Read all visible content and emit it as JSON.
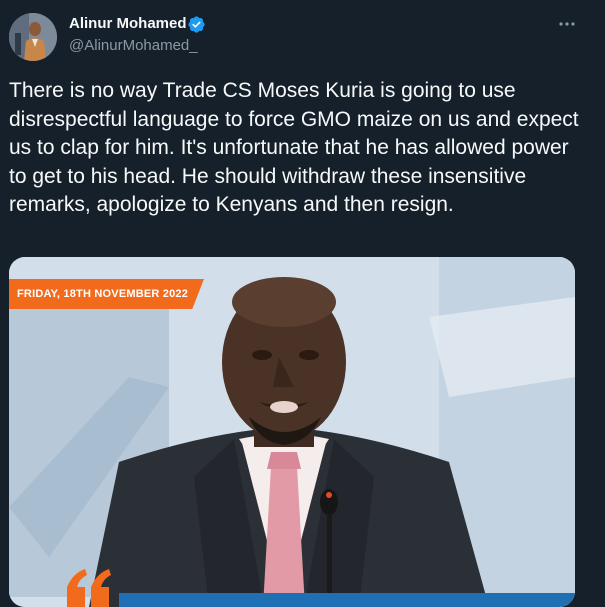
{
  "tweet": {
    "author_name": "Alinur Mohamed",
    "author_handle": "@AlinurMohamed_",
    "verified": true,
    "text": "There is no way Trade CS Moses Kuria is going to use disrespectful language to force GMO maize on us and expect us to clap for him. It's unfortunate that he has allowed power to get to his head. He should withdraw these insensitive remarks, apologize to Kenyans and then resign.",
    "media": {
      "date_banner": "FRIDAY, 18TH NOVEMBER 2022",
      "banner_color": "#f26b1d"
    }
  },
  "icons": {
    "verified": "verified-badge-icon",
    "more": "more-options-icon"
  },
  "colors": {
    "background": "#15202b",
    "text": "#f7f9f9",
    "secondary_text": "#8b98a5",
    "verified_blue": "#1d9bf0"
  }
}
